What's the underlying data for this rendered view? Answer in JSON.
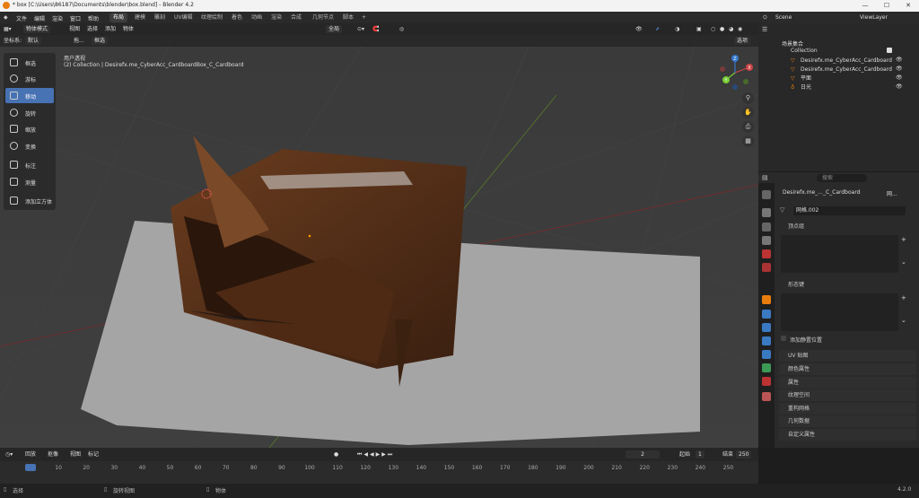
{
  "window": {
    "title": "* box [C:\\Users\\86187\\Documents\\blender\\box.blend] - Blender 4.2",
    "minimize": "—",
    "maximize": "☐",
    "close": "✕"
  },
  "menu": {
    "items": [
      "文件",
      "编辑",
      "渲染",
      "窗口",
      "帮助"
    ]
  },
  "workspaces": [
    "布局",
    "建模",
    "雕刻",
    "UV编辑",
    "纹理绘制",
    "着色",
    "动画",
    "渲染",
    "合成",
    "几何节点",
    "脚本"
  ],
  "workspace_add": "+",
  "scene": {
    "label": "Scene",
    "viewlayer": "ViewLayer"
  },
  "viewport_header": {
    "mode": "物体模式",
    "menus": [
      "视图",
      "选择",
      "添加",
      "物体"
    ],
    "transform": "全局",
    "options": "选项",
    "coord_label": "坐标系:",
    "coord_value": "默认",
    "drag_label": "拖...",
    "select_mode": "框选"
  },
  "viewport": {
    "title": "用户透视",
    "subtitle": "(2) Collection | Desirefx.me_CyberAcc_CardboardBox_C_Cardboard"
  },
  "tools": [
    {
      "label": "框选",
      "active": false
    },
    {
      "label": "游标",
      "active": false
    },
    {
      "label": "移动",
      "active": true
    },
    {
      "label": "旋转",
      "active": false
    },
    {
      "label": "缩放",
      "active": false
    },
    {
      "label": "变换",
      "active": false
    },
    {
      "label": "标注",
      "active": false
    },
    {
      "label": "测量",
      "active": false
    },
    {
      "label": "添加立方体",
      "active": false
    }
  ],
  "gizmo": {
    "x": "X",
    "y": "Y",
    "z": "Z"
  },
  "outliner": {
    "root": "场景集合",
    "collection": "Collection",
    "items": [
      "Desirefx.me_CyberAcc_Cardboard",
      "Desirefx.me_CyberAcc_Cardboard",
      "平面",
      "日光"
    ]
  },
  "properties": {
    "search_placeholder": "搜索",
    "object_name": "Desirefx.me_..._C_Cardboard",
    "data_short": "网...",
    "mesh_name": "网格.002",
    "sections_open": [
      "顶点组",
      "形态键"
    ],
    "add_rest_position": "添加静置位置",
    "sections_closed": [
      "UV 贴图",
      "颜色属性",
      "属性",
      "纹理空间",
      "重构网格",
      "几何数据",
      "自定义属性"
    ]
  },
  "timeline": {
    "menus": [
      "回放",
      "抠像",
      "视图",
      "标记"
    ],
    "current_frame": "2",
    "start_label": "起始",
    "start": "1",
    "end_label": "结束",
    "end": "250",
    "ticks": [
      "0",
      "10",
      "20",
      "30",
      "40",
      "50",
      "60",
      "70",
      "80",
      "90",
      "100",
      "110",
      "120",
      "130",
      "140",
      "150",
      "160",
      "170",
      "180",
      "190",
      "200",
      "210",
      "220",
      "230",
      "240",
      "250"
    ]
  },
  "statusbar": {
    "left": "选择",
    "middle": "旋转视图",
    "right": "物体",
    "version": "4.2.0"
  },
  "colors": {
    "accent": "#4772b3",
    "bg": "#1d1d1d",
    "orange": "#e87d0d"
  }
}
